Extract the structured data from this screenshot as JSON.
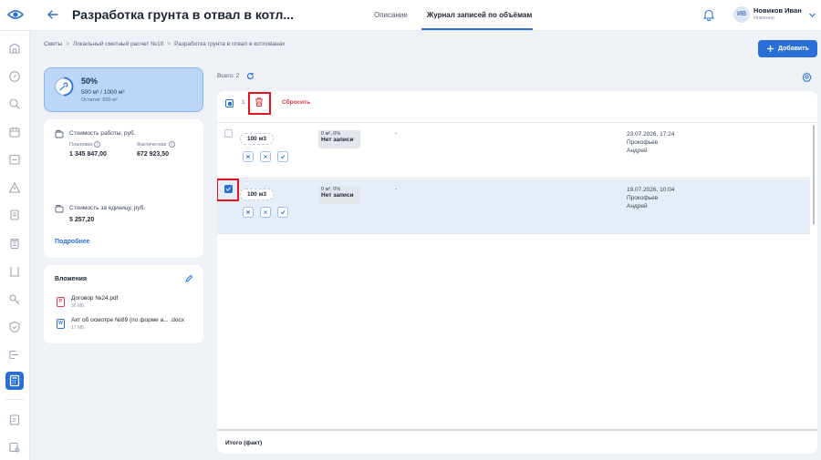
{
  "header": {
    "title": "Разработка грунта в отвал в котл...",
    "tabs": [
      {
        "label": "Описание",
        "active": false
      },
      {
        "label": "Журнал записей по объёмам",
        "active": true
      }
    ],
    "user": {
      "initials": "ИВ",
      "name": "Новиков Иван",
      "role": "Инженер"
    }
  },
  "breadcrumb": [
    "Сметы",
    "Локальный сметный расчет №10",
    "Разработка грунта в отвал в котлованах"
  ],
  "add_button_label": "Добавить",
  "progress": {
    "percent_label": "50%",
    "percent": 50,
    "volume": "500 м³ / 1000 м³",
    "remainder": "Остаток: 500 м³"
  },
  "cost": {
    "work_title": "Стоимость работы, руб.",
    "planned_label": "Плановая",
    "planned_value": "1 345 847,00",
    "actual_label": "Фактическая",
    "actual_value": "672 923,50",
    "unit_title": "Стоимость за единицу, руб.",
    "unit_value": "5 257,20",
    "more_link": "Подробнее"
  },
  "attachments": {
    "title": "Вложения",
    "files": [
      {
        "name": "Договор №24.pdf",
        "size": "36 МБ",
        "type": "P"
      },
      {
        "name": "Акт об осмотре №89 (по форме а... .docx",
        "size": "17 МБ",
        "type": "W"
      }
    ]
  },
  "list": {
    "total_label": "Всего: 2",
    "selected_count": "1",
    "reset_label": "Сбросить",
    "footer_label": "Итого (факт)",
    "rows": [
      {
        "volume": "100 м3",
        "fact": "0 м², 0%",
        "status": "Нет записи",
        "comment": "-",
        "datetime": "23.07.2026, 17:24",
        "last_name": "Прокофьев",
        "first_name": "Андрей",
        "selected": false
      },
      {
        "volume": "100 м3",
        "fact": "0 м², 0%",
        "status": "Нет записи",
        "comment": "-",
        "datetime": "19.07.2026, 10:04",
        "last_name": "Прокофьев",
        "first_name": "Андрей",
        "selected": true
      }
    ]
  },
  "colors": {
    "accent": "#2a6fd6",
    "danger": "#e0394b",
    "highlight": "#e0141e",
    "progress_bg": "#bcd6f7"
  }
}
